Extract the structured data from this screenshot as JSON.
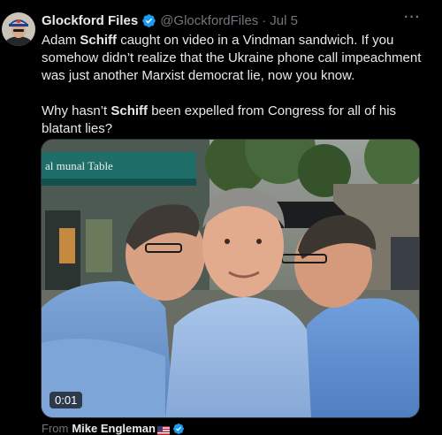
{
  "author": {
    "display_name": "Glockford Files",
    "handle": "@GlockfordFiles",
    "separator": "·",
    "date": "Jul 5"
  },
  "tweet": {
    "p1_a": "Adam ",
    "p1_bold": "Schiff",
    "p1_b": " caught  on video in a Vindman sandwich. If you somehow didn’t realize that the Ukraine phone call impeachment was just another Marxist democrat lie, now you know.",
    "p2_a": "Why hasn’t ",
    "p2_bold": "Schiff",
    "p2_b": " been expelled from Congress for all of his blatant lies?"
  },
  "media": {
    "duration": "0:01",
    "sign_text": "al munal Table"
  },
  "attribution": {
    "prefix": "From",
    "name": "Mike Engleman"
  },
  "icons": {
    "verified": "verified-badge-icon",
    "more": "more-options-icon",
    "flag": "us-flag-icon"
  },
  "colors": {
    "background": "#000000",
    "text": "#e7e9ea",
    "secondary": "#71767b",
    "verified": "#1d9bf0"
  }
}
